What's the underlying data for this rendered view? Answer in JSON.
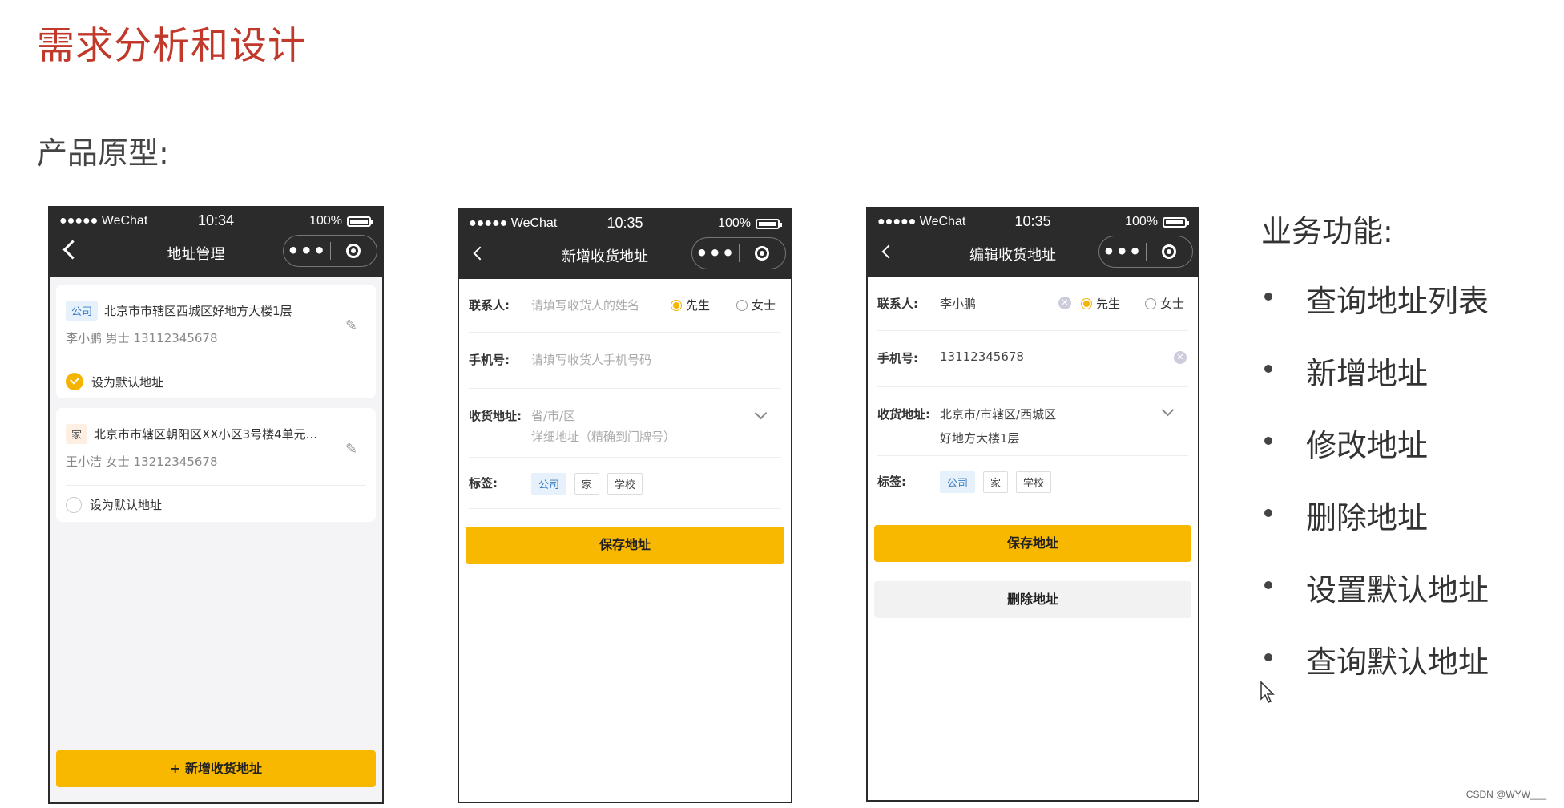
{
  "slide": {
    "title": "需求分析和设计",
    "prototype_label": "产品原型:"
  },
  "status": {
    "carrier": "●●●●● WeChat",
    "battery": "100%"
  },
  "phone1": {
    "time": "10:34",
    "nav_title": "地址管理",
    "cards": [
      {
        "tag": "公司",
        "address": "北京市市辖区西城区好地方大楼1层",
        "contact": "李小鹏 男士  13112345678",
        "default_label": "设为默认地址",
        "is_default": true
      },
      {
        "tag": "家",
        "address": "北京市市辖区朝阳区XX小区3号楼4单元...",
        "contact": "王小洁 女士  13212345678",
        "default_label": "设为默认地址",
        "is_default": false
      }
    ],
    "add_button": "+ 新增收货地址"
  },
  "phone2": {
    "time": "10:35",
    "nav_title": "新增收货地址",
    "contact_label": "联系人:",
    "contact_placeholder": "请填写收货人的姓名",
    "gender_male": "先生",
    "gender_female": "女士",
    "phone_label": "手机号:",
    "phone_placeholder": "请填写收货人手机号码",
    "address_label": "收货地址:",
    "region_placeholder": "省/市/区",
    "detail_placeholder": "详细地址（精确到门牌号）",
    "tags_label": "标签:",
    "tags": [
      "公司",
      "家",
      "学校"
    ],
    "save_button": "保存地址"
  },
  "phone3": {
    "time": "10:35",
    "nav_title": "编辑收货地址",
    "contact_label": "联系人:",
    "contact_value": "李小鹏",
    "gender_male": "先生",
    "gender_female": "女士",
    "phone_label": "手机号:",
    "phone_value": "13112345678",
    "address_label": "收货地址:",
    "region_value": "北京市/市辖区/西城区",
    "detail_value": "好地方大楼1层",
    "tags_label": "标签:",
    "tags": [
      "公司",
      "家",
      "学校"
    ],
    "save_button": "保存地址",
    "delete_button": "删除地址"
  },
  "features": {
    "title": "业务功能:",
    "items": [
      "查询地址列表",
      "新增地址",
      "修改地址",
      "删除地址",
      "设置默认地址",
      "查询默认地址"
    ]
  },
  "watermark": "CSDN @WYW___",
  "colors": {
    "title_red": "#c0392b",
    "accent_yellow": "#f9b800",
    "topbar": "#2b2b2b"
  }
}
